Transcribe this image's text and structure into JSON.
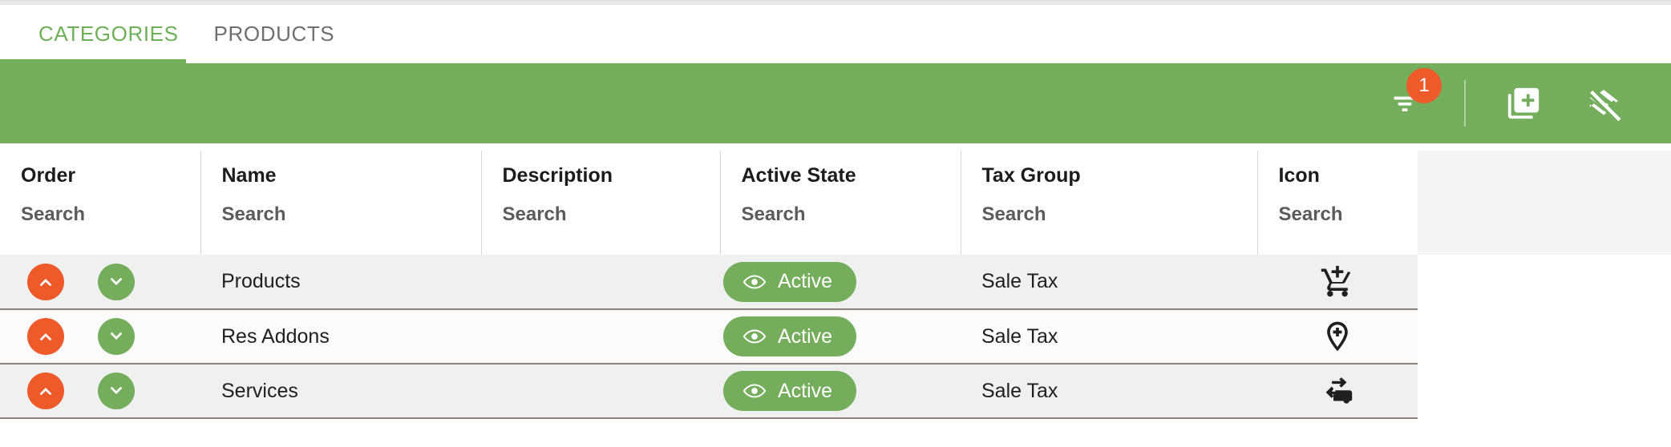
{
  "tabs": [
    {
      "label": "CATEGORIES",
      "active": true,
      "name": "tab-categories"
    },
    {
      "label": "PRODUCTS",
      "active": false,
      "name": "tab-products"
    }
  ],
  "toolbar": {
    "filter": {
      "icon": "filter-list-icon",
      "badge_count": "1"
    },
    "add": {
      "icon": "library-add-icon"
    },
    "layers_clear": {
      "icon": "layers-clear-icon"
    }
  },
  "table": {
    "columns": [
      {
        "title": "Order",
        "search_placeholder": "Search"
      },
      {
        "title": "Name",
        "search_placeholder": "Search"
      },
      {
        "title": "Description",
        "search_placeholder": "Search"
      },
      {
        "title": "Active State",
        "search_placeholder": "Search"
      },
      {
        "title": "Tax Group",
        "search_placeholder": "Search"
      },
      {
        "title": "Icon",
        "search_placeholder": "Search"
      }
    ],
    "rows": [
      {
        "order_up": "move-up-button",
        "order_down": "move-down-button",
        "name": "Products",
        "description": "",
        "active_state": "Active",
        "tax_group": "Sale Tax",
        "icon": "add-shopping-cart-icon"
      },
      {
        "order_up": "move-up-button",
        "order_down": "move-down-button",
        "name": "Res Addons",
        "description": "",
        "active_state": "Active",
        "tax_group": "Sale Tax",
        "icon": "add-location-icon"
      },
      {
        "order_up": "move-up-button",
        "order_down": "move-down-button",
        "name": "Services",
        "description": "",
        "active_state": "Active",
        "tax_group": "Sale Tax",
        "icon": "rv-transfer-icon"
      }
    ]
  },
  "colors": {
    "brand_green": "#74ad5c",
    "tab_green": "#6faf58",
    "accent_orange": "#ef5a2a",
    "row_odd": "#f0f0f0",
    "row_even": "#fbfbfb",
    "row_border": "#8d8281"
  }
}
